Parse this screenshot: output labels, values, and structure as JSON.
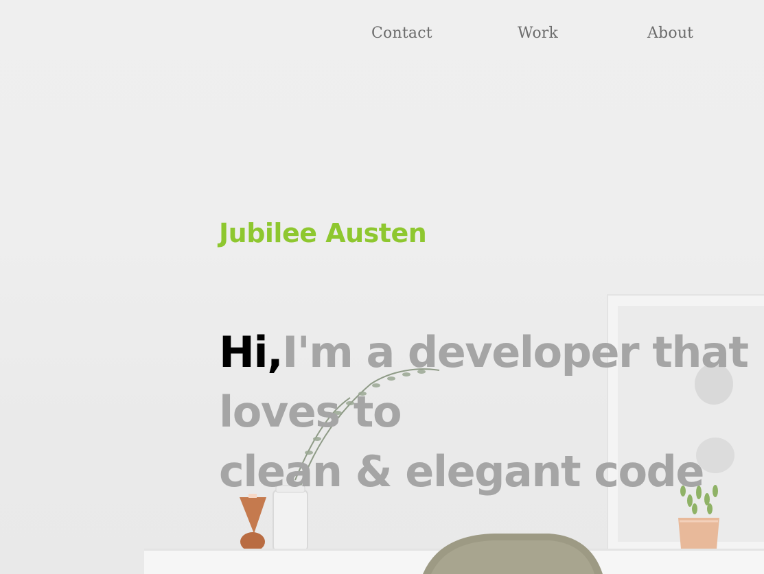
{
  "nav": {
    "items": [
      {
        "label": "Contact"
      },
      {
        "label": "Work"
      },
      {
        "label": "About"
      }
    ]
  },
  "hero": {
    "name": "Jubilee Austen",
    "greeting": "Hi,",
    "headline_line1": "I'm a developer that",
    "headline_line2": "loves to",
    "headline_line3": "clean & elegant code"
  },
  "colors": {
    "background": "#ededed",
    "name_accent": "#8ec72f",
    "greeting": "#000000",
    "headline": "#a5a5a5",
    "nav_text": "#6c6c6c"
  }
}
